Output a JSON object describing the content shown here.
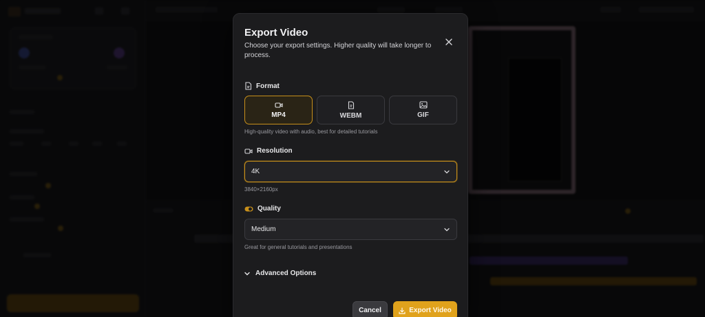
{
  "modal": {
    "title": "Export Video",
    "description": "Choose your export settings. Higher quality will take longer to process.",
    "format": {
      "label": "Format",
      "options": [
        {
          "label": "MP4",
          "icon": "video-camera-icon",
          "selected": true
        },
        {
          "label": "WEBM",
          "icon": "document-icon",
          "selected": false
        },
        {
          "label": "GIF",
          "icon": "image-icon",
          "selected": false
        }
      ],
      "hint": "High-quality video with audio, best for detailed tutorials"
    },
    "resolution": {
      "label": "Resolution",
      "value": "4K",
      "hint": "3840×2160px"
    },
    "quality": {
      "label": "Quality",
      "value": "Medium",
      "hint": "Great for general tutorials and presentations"
    },
    "advanced_label": "Advanced Options",
    "cancel_label": "Cancel",
    "export_label": "Export Video"
  },
  "colors": {
    "accent": "#e0a21c",
    "accent_border": "#c8901a",
    "modal_bg": "#1c1c1e"
  }
}
